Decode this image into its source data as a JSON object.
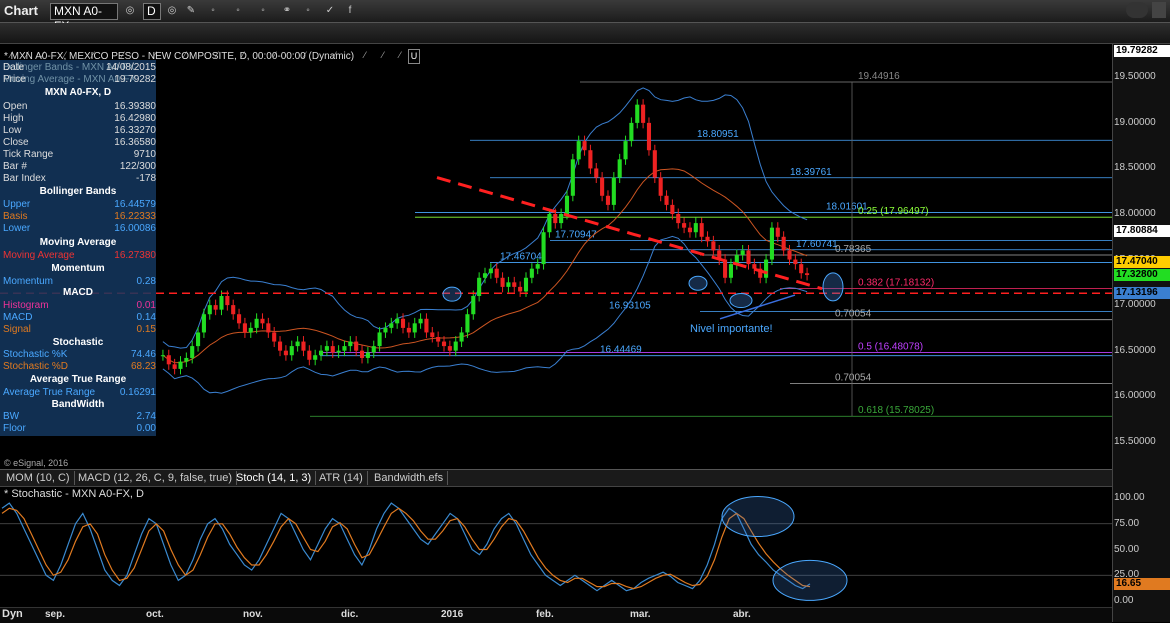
{
  "window": {
    "title": "Chart",
    "symbol": "MXN A0-FX",
    "interval": "D"
  },
  "chart_header": "* MXN A0-FX, MEXICO PESO - NEW COMPOSITE, D, 00:00-00:00 (Dynamic)",
  "overlay_labels": {
    "bb": "Bollinger Bands - MXN A0-FX",
    "ma": "Moving Average - MXN A0-FX"
  },
  "panel": {
    "date": {
      "label": "Date",
      "value": "14/08/2015"
    },
    "price": {
      "label": "Price",
      "value": "19.79282"
    },
    "header1": "MXN A0-FX, D",
    "rows1": [
      {
        "label": "Open",
        "value": "16.39380"
      },
      {
        "label": "High",
        "value": "16.42980"
      },
      {
        "label": "Low",
        "value": "16.33270"
      },
      {
        "label": "Close",
        "value": "16.36580"
      },
      {
        "label": "Tick Range",
        "value": "9710"
      },
      {
        "label": "Bar #",
        "value": "122/300"
      },
      {
        "label": "Bar Index",
        "value": "-178"
      }
    ],
    "header_bb": "Bollinger Bands",
    "bb_rows": [
      {
        "label": "Upper",
        "value": "16.44579"
      },
      {
        "label": "Basis",
        "value": "16.22333"
      },
      {
        "label": "Lower",
        "value": "16.00086"
      }
    ],
    "header_ma": "Moving Average",
    "ma_row": {
      "label": "Moving Average",
      "value": "16.27380"
    },
    "header_mom": "Momentum",
    "mom_row": {
      "label": "Momentum",
      "value": "0.28"
    },
    "header_macd": "MACD",
    "macd_rows": [
      {
        "label": "Histogram",
        "value": "0.01"
      },
      {
        "label": "MACD",
        "value": "0.14"
      },
      {
        "label": "Signal",
        "value": "0.15"
      }
    ],
    "header_stoch": "Stochastic",
    "stoch_rows": [
      {
        "label": "Stochastic %K",
        "value": "74.46"
      },
      {
        "label": "Stochastic %D",
        "value": "68.23"
      }
    ],
    "header_atr": "Average True Range",
    "atr_row": {
      "label": "Average True Range",
      "value": "0.16291"
    },
    "header_bw": "BandWidth",
    "bw_rows": [
      {
        "label": "BW",
        "value": "2.74"
      },
      {
        "label": "Floor",
        "value": "0.00"
      }
    ]
  },
  "copyright": "© eSignal, 2016",
  "tabs": [
    "MOM (10, C)",
    "MACD (12, 26, C, 9, false, true)",
    "Stoch (14, 1, 3)",
    "ATR (14)",
    "Bandwidth.efs"
  ],
  "stoch_title": "* Stochastic - MXN A0-FX, D",
  "footer_left": "Dyn",
  "colors": {
    "up": "#22dd22",
    "down": "#ee2222",
    "bb": "#3a7fd0",
    "ma": "#cc5522",
    "trend": "#ff2020",
    "fib": "#4aa8ff",
    "k": "#3a8ad0",
    "d": "#e07a20"
  },
  "chart_data": [
    {
      "type": "candlestick",
      "x_labels": [
        "sep.",
        "oct.",
        "nov.",
        "dic.",
        "2016",
        "feb.",
        "mar.",
        "abr."
      ],
      "ylim": [
        15.3,
        19.8
      ],
      "y_ticks": [
        "19.79282",
        "19.50000",
        "19.00000",
        "18.50000",
        "18.00000",
        "17.50000",
        "17.00000",
        "16.50000",
        "16.00000",
        "15.50000"
      ],
      "price_badges": [
        {
          "value": "19.79282",
          "color": "#ffffff"
        },
        {
          "value": "17.80884",
          "color": "#ffffff"
        },
        {
          "value": "17.47040",
          "color": "#ffcc00"
        },
        {
          "value": "17.32800",
          "color": "#22dd22"
        },
        {
          "value": "17.13196",
          "color": "#3a7fd0"
        }
      ],
      "close": [
        16.45,
        16.35,
        16.3,
        16.38,
        16.42,
        16.55,
        16.7,
        16.9,
        17.0,
        16.95,
        17.1,
        17.0,
        16.9,
        16.8,
        16.7,
        16.75,
        16.85,
        16.8,
        16.7,
        16.6,
        16.5,
        16.45,
        16.55,
        16.6,
        16.5,
        16.4,
        16.45,
        16.5,
        16.55,
        16.48,
        16.5,
        16.55,
        16.6,
        16.5,
        16.42,
        16.48,
        16.55,
        16.7,
        16.75,
        16.8,
        16.85,
        16.75,
        16.7,
        16.8,
        16.85,
        16.7,
        16.65,
        16.6,
        16.55,
        16.5,
        16.6,
        16.7,
        16.9,
        17.1,
        17.3,
        17.35,
        17.4,
        17.3,
        17.2,
        17.25,
        17.2,
        17.15,
        17.3,
        17.4,
        17.45,
        17.8,
        18.0,
        17.9,
        18.0,
        18.2,
        18.6,
        18.8,
        18.7,
        18.5,
        18.4,
        18.2,
        18.1,
        18.4,
        18.6,
        18.8,
        19.0,
        19.2,
        19.0,
        18.7,
        18.4,
        18.2,
        18.1,
        18.0,
        17.9,
        17.85,
        17.8,
        17.9,
        17.75,
        17.7,
        17.6,
        17.5,
        17.3,
        17.45,
        17.55,
        17.6,
        17.45,
        17.4,
        17.3,
        17.5,
        17.85,
        17.75,
        17.6,
        17.5,
        17.45,
        17.35,
        17.33
      ],
      "fib_levels": [
        {
          "label": "19.44916",
          "value": 19.44916
        },
        {
          "label": "18.80951",
          "value": 18.80951
        },
        {
          "label": "18.39761",
          "value": 18.39761
        },
        {
          "label": "18.01601",
          "value": 18.01601
        },
        {
          "label": "0.25 (17.96497)",
          "value": 17.96497
        },
        {
          "label": "17.70947",
          "value": 17.70947
        },
        {
          "label": "17.60741",
          "value": 17.60741
        },
        {
          "label": "0.78365",
          "value": 17.55
        },
        {
          "label": "17.46704",
          "value": 17.46704
        },
        {
          "label": "0.382 (17.18132)",
          "value": 17.18132
        },
        {
          "label": "16.93105",
          "value": 16.93105
        },
        {
          "label": "0.70054",
          "value": 16.84
        },
        {
          "label": "0.5 (16.48078)",
          "value": 16.48078
        },
        {
          "label": "16.44469",
          "value": 16.44469
        },
        {
          "label": "0.70054",
          "value": 16.14
        },
        {
          "label": "0.618 (15.78025)",
          "value": 15.78025
        }
      ],
      "annotation": "Nivel importante!"
    },
    {
      "type": "line",
      "title": "Stochastic",
      "y_ticks": [
        "100.00",
        "75.00",
        "50.00",
        "25.00",
        "0.00"
      ],
      "ylim": [
        0,
        100
      ],
      "last_value": "16.65",
      "series": [
        {
          "name": "%K",
          "values": [
            90,
            95,
            85,
            70,
            55,
            40,
            25,
            20,
            35,
            55,
            75,
            85,
            70,
            50,
            30,
            20,
            15,
            25,
            45,
            65,
            80,
            75,
            55,
            35,
            20,
            25,
            40,
            60,
            75,
            80,
            70,
            55,
            45,
            35,
            30,
            40,
            55,
            70,
            85,
            80,
            65,
            50,
            40,
            55,
            70,
            80,
            75,
            60,
            45,
            35,
            50,
            70,
            85,
            95,
            90,
            80,
            70,
            60,
            55,
            65,
            75,
            85,
            80,
            65,
            50,
            45,
            55,
            70,
            80,
            85,
            75,
            60,
            45,
            35,
            25,
            20,
            15,
            20,
            25,
            20,
            15,
            10,
            15,
            20,
            15,
            10,
            12,
            18,
            22,
            25,
            28,
            24,
            18,
            15,
            12,
            20,
            35,
            55,
            80,
            90,
            85,
            70,
            55,
            45,
            38,
            30,
            25,
            20,
            15,
            12,
            16.65
          ]
        },
        {
          "name": "%D",
          "values": [
            85,
            90,
            88,
            80,
            65,
            50,
            35,
            25,
            28,
            40,
            58,
            72,
            75,
            65,
            45,
            30,
            20,
            22,
            32,
            50,
            68,
            75,
            68,
            50,
            35,
            25,
            30,
            45,
            62,
            75,
            75,
            65,
            52,
            42,
            35,
            35,
            45,
            58,
            72,
            80,
            75,
            62,
            50,
            48,
            58,
            72,
            76,
            70,
            55,
            42,
            45,
            58,
            72,
            85,
            90,
            85,
            78,
            68,
            60,
            60,
            68,
            78,
            80,
            72,
            60,
            50,
            50,
            60,
            72,
            80,
            78,
            68,
            55,
            42,
            32,
            25,
            20,
            18,
            22,
            22,
            18,
            14,
            14,
            17,
            17,
            14,
            12,
            14,
            18,
            22,
            25,
            26,
            22,
            18,
            15,
            16,
            24,
            40,
            62,
            80,
            85,
            80,
            68,
            56,
            46,
            38,
            31,
            25,
            20,
            15,
            14
          ]
        }
      ]
    }
  ]
}
